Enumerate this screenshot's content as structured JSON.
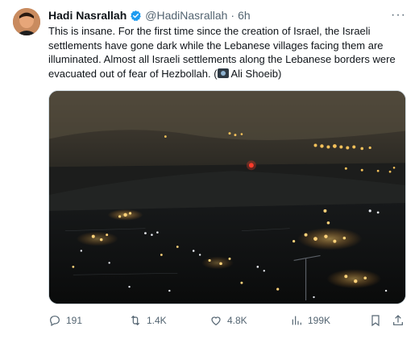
{
  "tweet": {
    "display_name": "Hadi Nasrallah",
    "handle": "@HadiNasrallah",
    "separator": "·",
    "time": "6h",
    "more": "···",
    "text_before_icon": "This is insane. For the first time since the creation of Israel, the Israeli settlements have gone dark while the Lebanese villages facing them are illuminated. Almost all Israeli settlements along the Lebanese borders were evacuated out of fear of Hezbollah. (",
    "text_after_icon": " Ali Shoeib)",
    "camera_icon": "camera-icon",
    "verified_icon": "verified-badge-icon",
    "verified_color": "#1d9bf0"
  },
  "actions": {
    "replies": "191",
    "reposts": "1.4K",
    "likes": "4.8K",
    "views": "199K",
    "icons": [
      "reply-icon",
      "repost-icon",
      "like-icon",
      "views-icon",
      "bookmark-icon",
      "share-icon"
    ]
  }
}
